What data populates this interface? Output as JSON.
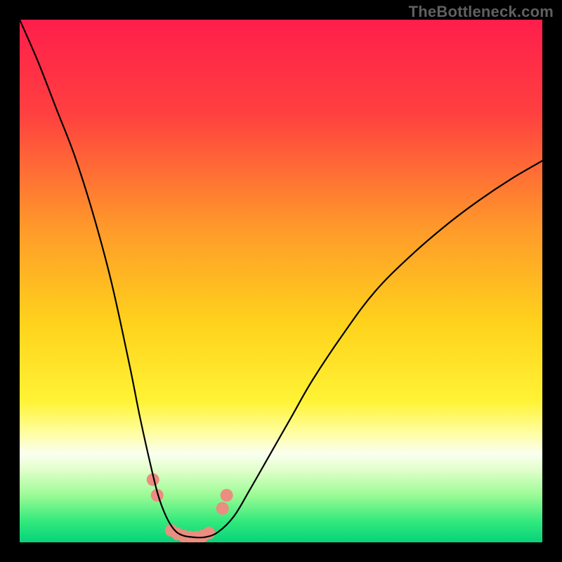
{
  "watermark": "TheBottleneck.com",
  "colors": {
    "frame": "#000000",
    "curve": "#000000",
    "marker": "#eb8d80",
    "watermark": "#606060",
    "gradient_stops": [
      {
        "offset": 0.0,
        "color": "#ff1e4b"
      },
      {
        "offset": 0.18,
        "color": "#ff4040"
      },
      {
        "offset": 0.4,
        "color": "#ff9a2a"
      },
      {
        "offset": 0.58,
        "color": "#ffd21c"
      },
      {
        "offset": 0.73,
        "color": "#fff335"
      },
      {
        "offset": 0.79,
        "color": "#fffea0"
      },
      {
        "offset": 0.83,
        "color": "#fafff0"
      },
      {
        "offset": 0.86,
        "color": "#e3ffcc"
      },
      {
        "offset": 0.91,
        "color": "#9bfb95"
      },
      {
        "offset": 0.96,
        "color": "#32e97d"
      },
      {
        "offset": 1.0,
        "color": "#06d37a"
      }
    ]
  },
  "chart_data": {
    "type": "line",
    "title": "",
    "xlabel": "",
    "ylabel": "",
    "xlim": [
      0,
      100
    ],
    "ylim": [
      0,
      100
    ],
    "x": [
      0,
      3.5,
      7,
      10.5,
      14,
      17.5,
      21,
      23,
      25,
      26.5,
      28,
      29.5,
      31,
      33,
      35.5,
      38,
      41,
      44,
      48,
      52,
      56,
      62,
      68,
      75,
      82,
      88,
      94,
      100
    ],
    "values": [
      100,
      92,
      83,
      74,
      63,
      50,
      34,
      24,
      15,
      9,
      5,
      2.5,
      1.4,
      1,
      1,
      2,
      5,
      10,
      17,
      24,
      31,
      40,
      48,
      55,
      61,
      65.5,
      69.5,
      73
    ],
    "marker_points": [
      {
        "x": 25.5,
        "y": 12
      },
      {
        "x": 26.3,
        "y": 9
      },
      {
        "x": 29.0,
        "y": 2.3
      },
      {
        "x": 30.2,
        "y": 1.6
      },
      {
        "x": 31.4,
        "y": 1.2
      },
      {
        "x": 32.6,
        "y": 1.0
      },
      {
        "x": 33.8,
        "y": 1.0
      },
      {
        "x": 35.0,
        "y": 1.2
      },
      {
        "x": 36.2,
        "y": 1.8
      },
      {
        "x": 38.8,
        "y": 6.5
      },
      {
        "x": 39.6,
        "y": 9.0
      }
    ],
    "marker_radius_px": 9
  }
}
